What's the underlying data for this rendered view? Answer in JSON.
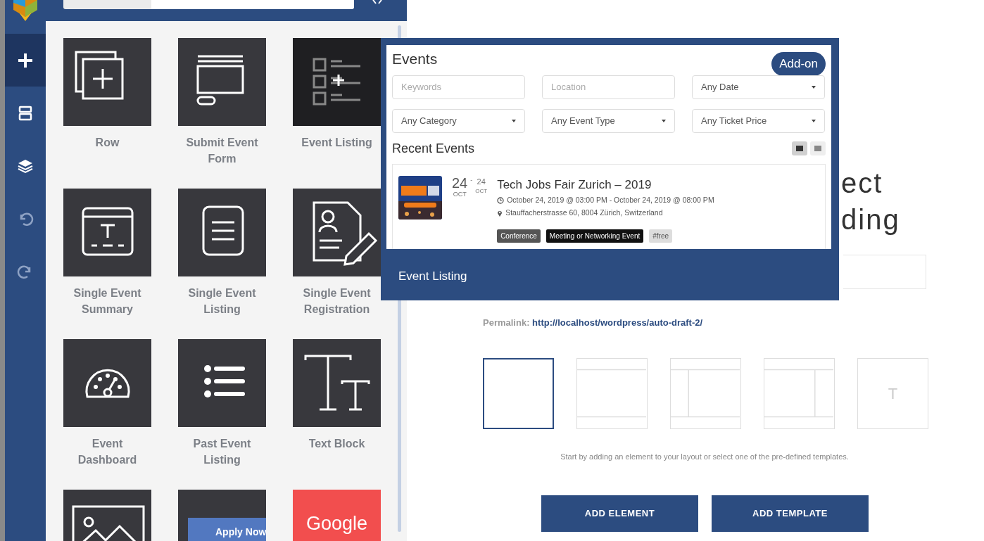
{
  "sidebar": {
    "items": [
      {
        "selected": true
      },
      {
        "selected": false
      },
      {
        "selected": false
      },
      {
        "selected": false
      },
      {
        "selected": false
      }
    ]
  },
  "panel": {
    "tiles": [
      {
        "label": "Row",
        "hovered": false
      },
      {
        "label": "Submit Event Form",
        "hovered": false
      },
      {
        "label": "Event Listing",
        "hovered": true
      },
      {
        "label": "Single Event Summary",
        "hovered": false
      },
      {
        "label": "Single Event Listing",
        "hovered": false
      },
      {
        "label": "Single Event Registration",
        "hovered": false
      },
      {
        "label": "Event Dashboard",
        "hovered": false
      },
      {
        "label": "Past Event Listing",
        "hovered": false
      },
      {
        "label": "Text Block",
        "hovered": false
      },
      {
        "hovered": false
      },
      {
        "caption": "Apply Now",
        "hovered": false
      },
      {
        "caption": "Google",
        "hovered": false
      }
    ]
  },
  "preview": {
    "title": "Events",
    "addon_button": "Add-on",
    "filters": [
      {
        "kind": "input",
        "placeholder": "Keywords"
      },
      {
        "kind": "input",
        "placeholder": "Location"
      },
      {
        "kind": "select",
        "value": "Any Date"
      },
      {
        "kind": "select",
        "value": "Any Category"
      },
      {
        "kind": "select",
        "value": "Any Event Type"
      },
      {
        "kind": "select",
        "value": "Any Ticket Price"
      }
    ],
    "section_title": "Recent Events",
    "views": [
      {
        "selected": true
      },
      {
        "selected": false
      }
    ],
    "event": {
      "day_start": "24",
      "month_start": "OCT",
      "separator": "-",
      "day_end": "24",
      "month_end": "OCT",
      "title": "Tech Jobs Fair Zurich – 2019",
      "time": "October 24, 2019 @ 03:00 PM - October 24, 2019 @ 08:00 PM",
      "address": "Stauffacherstrasse 60, 8004 Zürich, Switzerland",
      "tags": [
        {
          "label": "Conference",
          "color": "#555555"
        },
        {
          "label": "Meeting or Networking Event",
          "color": "#111111"
        },
        {
          "label": "#free",
          "color": "#dddddd"
        }
      ]
    },
    "caption": "Event Listing"
  },
  "main": {
    "heading_lines": [
      "ect",
      "ding"
    ],
    "permalink_label": "Permalink:",
    "permalink_url": "http://localhost/wordpress/auto-draft-2/",
    "templates": [
      {
        "kind": "blank",
        "selected": true
      },
      {
        "kind": "header-footer",
        "selected": false
      },
      {
        "kind": "left-sidebar",
        "selected": false
      },
      {
        "kind": "right-sidebar",
        "selected": false
      },
      {
        "kind": "text",
        "label": "T",
        "selected": false
      }
    ],
    "hint": "Start by adding an element to your layout or select one of the pre-defined templates.",
    "buttons": [
      "ADD ELEMENT",
      "ADD TEMPLATE"
    ]
  }
}
